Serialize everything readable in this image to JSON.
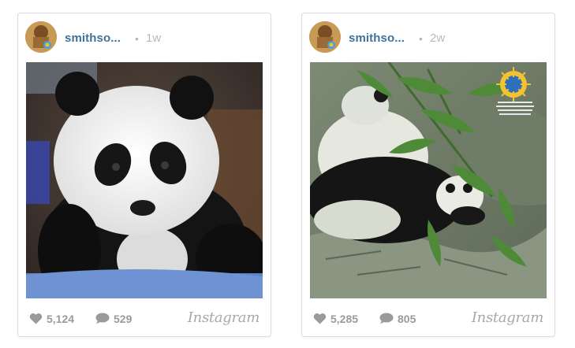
{
  "posts": [
    {
      "username": "smithso...",
      "age": "1w",
      "likes": "5,124",
      "comments": "529",
      "brand": "Instagram"
    },
    {
      "username": "smithso...",
      "age": "2w",
      "likes": "5,285",
      "comments": "805",
      "brand": "Instagram"
    }
  ],
  "separator": "•",
  "icons": {
    "like": "heart-icon",
    "comment": "speech-bubble-icon"
  },
  "colors": {
    "username": "#3f729b",
    "meta_gray": "#9a9a9a"
  }
}
